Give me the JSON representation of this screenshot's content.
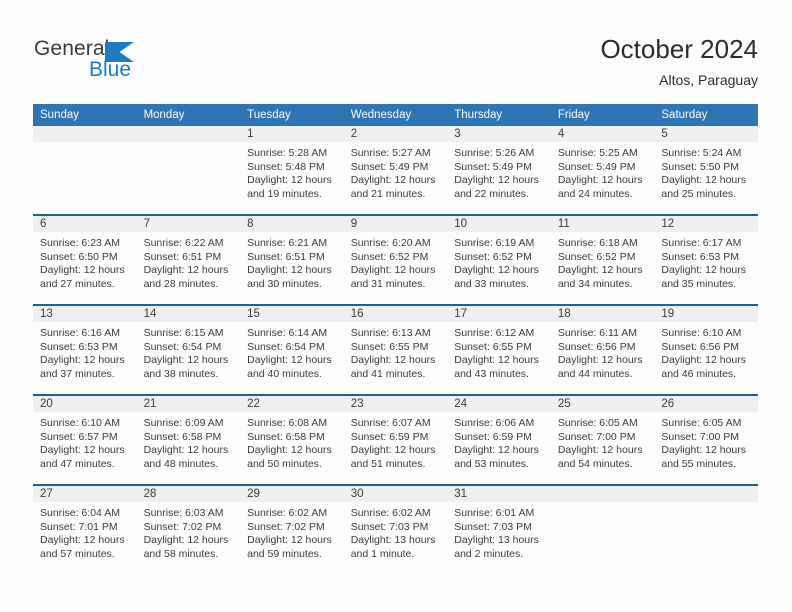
{
  "brand": {
    "word_one": "General",
    "word_two": "Blue",
    "triangle_color": "#1b7cc4",
    "word_one_color": "#3b3b3b",
    "word_two_color": "#1b7cc4"
  },
  "header": {
    "title": "October 2024",
    "subtitle": "Altos, Paraguay"
  },
  "theme": {
    "header_blue": "#2e75b6",
    "separator_blue": "#1f6099",
    "daynum_band": "#efefef",
    "text": "#3c3c3c",
    "page_bg": "#fdfdfd"
  },
  "weekday_headers": [
    "Sunday",
    "Monday",
    "Tuesday",
    "Wednesday",
    "Thursday",
    "Friday",
    "Saturday"
  ],
  "labels": {
    "sunrise_prefix": "Sunrise:",
    "sunset_prefix": "Sunset:",
    "daylight_prefix": "Daylight:"
  },
  "weeks": [
    [
      {
        "day": "",
        "lines": []
      },
      {
        "day": "",
        "lines": []
      },
      {
        "day": "1",
        "lines": [
          "Sunrise: 5:28 AM",
          "Sunset: 5:48 PM",
          "Daylight: 12 hours",
          "and 19 minutes."
        ]
      },
      {
        "day": "2",
        "lines": [
          "Sunrise: 5:27 AM",
          "Sunset: 5:49 PM",
          "Daylight: 12 hours",
          "and 21 minutes."
        ]
      },
      {
        "day": "3",
        "lines": [
          "Sunrise: 5:26 AM",
          "Sunset: 5:49 PM",
          "Daylight: 12 hours",
          "and 22 minutes."
        ]
      },
      {
        "day": "4",
        "lines": [
          "Sunrise: 5:25 AM",
          "Sunset: 5:49 PM",
          "Daylight: 12 hours",
          "and 24 minutes."
        ]
      },
      {
        "day": "5",
        "lines": [
          "Sunrise: 5:24 AM",
          "Sunset: 5:50 PM",
          "Daylight: 12 hours",
          "and 25 minutes."
        ]
      }
    ],
    [
      {
        "day": "6",
        "lines": [
          "Sunrise: 6:23 AM",
          "Sunset: 6:50 PM",
          "Daylight: 12 hours",
          "and 27 minutes."
        ]
      },
      {
        "day": "7",
        "lines": [
          "Sunrise: 6:22 AM",
          "Sunset: 6:51 PM",
          "Daylight: 12 hours",
          "and 28 minutes."
        ]
      },
      {
        "day": "8",
        "lines": [
          "Sunrise: 6:21 AM",
          "Sunset: 6:51 PM",
          "Daylight: 12 hours",
          "and 30 minutes."
        ]
      },
      {
        "day": "9",
        "lines": [
          "Sunrise: 6:20 AM",
          "Sunset: 6:52 PM",
          "Daylight: 12 hours",
          "and 31 minutes."
        ]
      },
      {
        "day": "10",
        "lines": [
          "Sunrise: 6:19 AM",
          "Sunset: 6:52 PM",
          "Daylight: 12 hours",
          "and 33 minutes."
        ]
      },
      {
        "day": "11",
        "lines": [
          "Sunrise: 6:18 AM",
          "Sunset: 6:52 PM",
          "Daylight: 12 hours",
          "and 34 minutes."
        ]
      },
      {
        "day": "12",
        "lines": [
          "Sunrise: 6:17 AM",
          "Sunset: 6:53 PM",
          "Daylight: 12 hours",
          "and 35 minutes."
        ]
      }
    ],
    [
      {
        "day": "13",
        "lines": [
          "Sunrise: 6:16 AM",
          "Sunset: 6:53 PM",
          "Daylight: 12 hours",
          "and 37 minutes."
        ]
      },
      {
        "day": "14",
        "lines": [
          "Sunrise: 6:15 AM",
          "Sunset: 6:54 PM",
          "Daylight: 12 hours",
          "and 38 minutes."
        ]
      },
      {
        "day": "15",
        "lines": [
          "Sunrise: 6:14 AM",
          "Sunset: 6:54 PM",
          "Daylight: 12 hours",
          "and 40 minutes."
        ]
      },
      {
        "day": "16",
        "lines": [
          "Sunrise: 6:13 AM",
          "Sunset: 6:55 PM",
          "Daylight: 12 hours",
          "and 41 minutes."
        ]
      },
      {
        "day": "17",
        "lines": [
          "Sunrise: 6:12 AM",
          "Sunset: 6:55 PM",
          "Daylight: 12 hours",
          "and 43 minutes."
        ]
      },
      {
        "day": "18",
        "lines": [
          "Sunrise: 6:11 AM",
          "Sunset: 6:56 PM",
          "Daylight: 12 hours",
          "and 44 minutes."
        ]
      },
      {
        "day": "19",
        "lines": [
          "Sunrise: 6:10 AM",
          "Sunset: 6:56 PM",
          "Daylight: 12 hours",
          "and 46 minutes."
        ]
      }
    ],
    [
      {
        "day": "20",
        "lines": [
          "Sunrise: 6:10 AM",
          "Sunset: 6:57 PM",
          "Daylight: 12 hours",
          "and 47 minutes."
        ]
      },
      {
        "day": "21",
        "lines": [
          "Sunrise: 6:09 AM",
          "Sunset: 6:58 PM",
          "Daylight: 12 hours",
          "and 48 minutes."
        ]
      },
      {
        "day": "22",
        "lines": [
          "Sunrise: 6:08 AM",
          "Sunset: 6:58 PM",
          "Daylight: 12 hours",
          "and 50 minutes."
        ]
      },
      {
        "day": "23",
        "lines": [
          "Sunrise: 6:07 AM",
          "Sunset: 6:59 PM",
          "Daylight: 12 hours",
          "and 51 minutes."
        ]
      },
      {
        "day": "24",
        "lines": [
          "Sunrise: 6:06 AM",
          "Sunset: 6:59 PM",
          "Daylight: 12 hours",
          "and 53 minutes."
        ]
      },
      {
        "day": "25",
        "lines": [
          "Sunrise: 6:05 AM",
          "Sunset: 7:00 PM",
          "Daylight: 12 hours",
          "and 54 minutes."
        ]
      },
      {
        "day": "26",
        "lines": [
          "Sunrise: 6:05 AM",
          "Sunset: 7:00 PM",
          "Daylight: 12 hours",
          "and 55 minutes."
        ]
      }
    ],
    [
      {
        "day": "27",
        "lines": [
          "Sunrise: 6:04 AM",
          "Sunset: 7:01 PM",
          "Daylight: 12 hours",
          "and 57 minutes."
        ]
      },
      {
        "day": "28",
        "lines": [
          "Sunrise: 6:03 AM",
          "Sunset: 7:02 PM",
          "Daylight: 12 hours",
          "and 58 minutes."
        ]
      },
      {
        "day": "29",
        "lines": [
          "Sunrise: 6:02 AM",
          "Sunset: 7:02 PM",
          "Daylight: 12 hours",
          "and 59 minutes."
        ]
      },
      {
        "day": "30",
        "lines": [
          "Sunrise: 6:02 AM",
          "Sunset: 7:03 PM",
          "Daylight: 13 hours",
          "and 1 minute."
        ]
      },
      {
        "day": "31",
        "lines": [
          "Sunrise: 6:01 AM",
          "Sunset: 7:03 PM",
          "Daylight: 13 hours",
          "and 2 minutes."
        ]
      },
      {
        "day": "",
        "lines": []
      },
      {
        "day": "",
        "lines": []
      }
    ]
  ]
}
